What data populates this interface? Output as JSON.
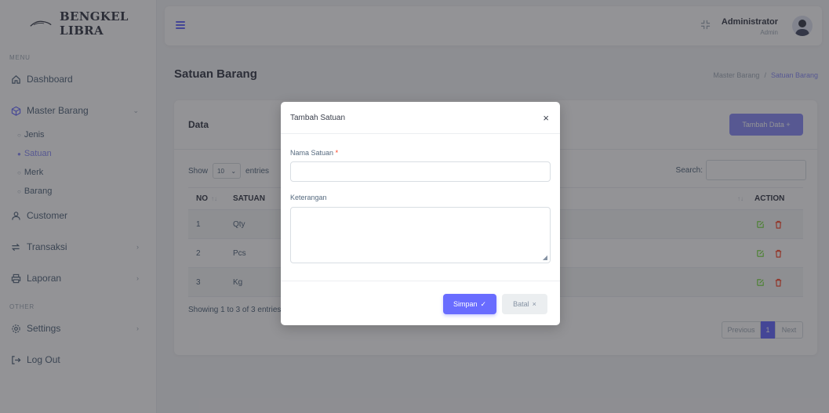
{
  "brand": {
    "name": "BENGKEL LIBRA"
  },
  "sidebar": {
    "menu_header": "MENU",
    "other_header": "OTHER",
    "items": {
      "dashboard": "Dashboard",
      "master_barang": "Master Barang",
      "jenis": "Jenis",
      "satuan": "Satuan",
      "merk": "Merk",
      "barang": "Barang",
      "customer": "Customer",
      "transaksi": "Transaksi",
      "laporan": "Laporan",
      "settings": "Settings",
      "logout": "Log Out"
    }
  },
  "topbar": {
    "user_name": "Administrator",
    "user_role": "Admin"
  },
  "page": {
    "title": "Satuan Barang",
    "breadcrumb": {
      "parent": "Master Barang",
      "separator": "/",
      "current": "Satuan Barang"
    }
  },
  "card": {
    "title": "Data",
    "add_button": "Tambah Data +",
    "show": "Show",
    "entries_value": "10",
    "entries": "entries",
    "search_label": "Search:",
    "columns": {
      "no": "NO",
      "satuan": "SATUAN",
      "action": "ACTION"
    },
    "rows": [
      {
        "no": "1",
        "satuan": "Qty"
      },
      {
        "no": "2",
        "satuan": "Pcs"
      },
      {
        "no": "3",
        "satuan": "Kg"
      }
    ],
    "info": "Showing 1 to 3 of 3 entries",
    "pager": {
      "prev": "Previous",
      "page": "1",
      "next": "Next"
    }
  },
  "modal": {
    "title": "Tambah Satuan",
    "close": "×",
    "field_nama": "Nama Satuan",
    "required_mark": "*",
    "field_keterangan": "Keterangan",
    "save_label": "Simpan",
    "save_icon": "✓",
    "cancel_label": "Batal",
    "cancel_icon": "×"
  },
  "colors": {
    "primary": "#696cff",
    "primary_light": "#8c8ff7",
    "danger": "#ff3e1d",
    "success": "#71dd37"
  }
}
